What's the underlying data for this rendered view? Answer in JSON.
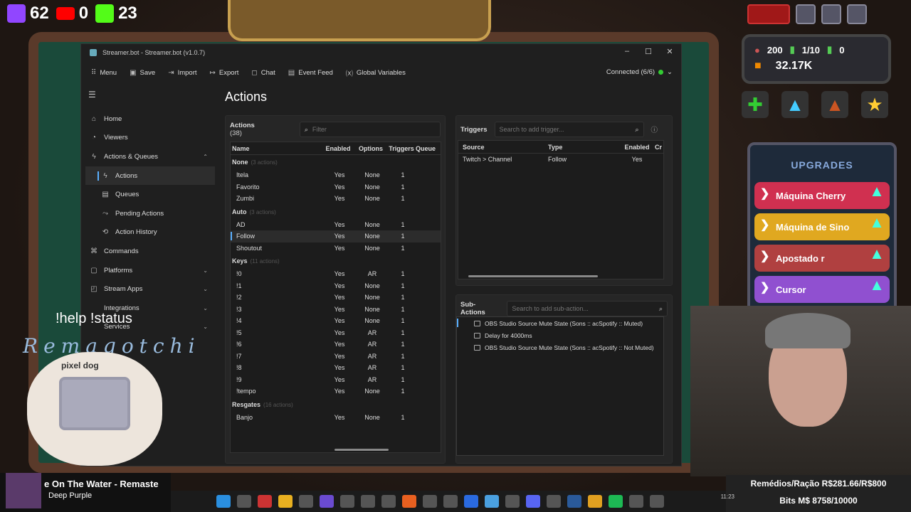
{
  "overlay": {
    "twitch_count": "62",
    "youtube_count": "0",
    "kick_count": "23",
    "help_text": "!help !status",
    "brand_name": "Remagotchi",
    "pet_brand": "pixel dog",
    "now_playing": {
      "title": "e On The Water - Remaste",
      "artist": "Deep Purple"
    },
    "game": {
      "stat1": "200",
      "stat2": "1/10",
      "stat3": "0",
      "money": "32.17K",
      "upgrades_title": "UPGRADES",
      "upgrades": [
        "Máquina Cherry",
        "Máquina de Sino",
        "Apostado r",
        "Cursor"
      ]
    },
    "bottom_line1": "Remédios/Ração R$281.66/R$800",
    "bottom_line2": "Bits M$ 8758/10000",
    "clock": "11:23"
  },
  "window": {
    "title": "Streamer.bot - Streamer.bot (v1.0.7)",
    "toolbar": [
      "Menu",
      "Save",
      "Import",
      "Export",
      "Chat",
      "Event Feed",
      "Global Variables"
    ],
    "connection": "Connected (6/6)",
    "nav": [
      {
        "label": "Home",
        "icon": "⌂",
        "sub": false
      },
      {
        "label": "Viewers",
        "icon": "◔",
        "sub": false
      },
      {
        "label": "Actions & Queues",
        "icon": "ϟ",
        "sub": false,
        "chev": "⌃"
      },
      {
        "label": "Actions",
        "icon": "ϟ",
        "sub": true,
        "active": true
      },
      {
        "label": "Queues",
        "icon": "▤",
        "sub": true
      },
      {
        "label": "Pending Actions",
        "icon": "⤳",
        "sub": true
      },
      {
        "label": "Action History",
        "icon": "⟲",
        "sub": true
      },
      {
        "label": "Commands",
        "icon": "⌘",
        "sub": false
      },
      {
        "label": "Platforms",
        "icon": "▢",
        "sub": false,
        "chev": "⌄"
      },
      {
        "label": "Stream Apps",
        "icon": "◰",
        "sub": false,
        "chev": "⌄"
      },
      {
        "label": "Integrations",
        "icon": "",
        "sub": false,
        "chev": "⌄"
      },
      {
        "label": "Services",
        "icon": "",
        "sub": false,
        "chev": "⌄"
      }
    ],
    "page_title": "Actions",
    "actions": {
      "label": "Actions",
      "count": "(38)",
      "filter_placeholder": "Filter",
      "columns": [
        "Name",
        "Enabled",
        "Options",
        "Triggers",
        "Queue"
      ],
      "groups": [
        {
          "name": "None",
          "count": "(3 actions)",
          "rows": [
            [
              "Itela",
              "Yes",
              "None",
              "1"
            ],
            [
              "Favorito",
              "Yes",
              "None",
              "1"
            ],
            [
              "Zumbi",
              "Yes",
              "None",
              "1"
            ]
          ]
        },
        {
          "name": "Auto",
          "count": "(3 actions)",
          "rows": [
            [
              "AD",
              "Yes",
              "None",
              "1"
            ],
            [
              "Follow",
              "Yes",
              "None",
              "1"
            ],
            [
              "Shoutout",
              "Yes",
              "None",
              "1"
            ]
          ]
        },
        {
          "name": "Keys",
          "count": "(11 actions)",
          "rows": [
            [
              "!0",
              "Yes",
              "AR",
              "1"
            ],
            [
              "!1",
              "Yes",
              "None",
              "1"
            ],
            [
              "!2",
              "Yes",
              "None",
              "1"
            ],
            [
              "!3",
              "Yes",
              "None",
              "1"
            ],
            [
              "!4",
              "Yes",
              "None",
              "1"
            ],
            [
              "!5",
              "Yes",
              "AR",
              "1"
            ],
            [
              "!6",
              "Yes",
              "AR",
              "1"
            ],
            [
              "!7",
              "Yes",
              "AR",
              "1"
            ],
            [
              "!8",
              "Yes",
              "AR",
              "1"
            ],
            [
              "!9",
              "Yes",
              "AR",
              "1"
            ],
            [
              "!tempo",
              "Yes",
              "None",
              "1"
            ]
          ]
        },
        {
          "name": "Resgates",
          "count": "(16 actions)",
          "rows": [
            [
              "Banjo",
              "Yes",
              "None",
              "1"
            ]
          ]
        }
      ]
    },
    "triggers": {
      "label": "Triggers",
      "search_placeholder": "Search to add trigger...",
      "columns": [
        "Source",
        "Type",
        "Enabled",
        "Cr"
      ],
      "rows": [
        [
          "Twitch > Channel",
          "Follow",
          "Yes"
        ]
      ]
    },
    "subactions": {
      "label": "Sub-Actions",
      "search_placeholder": "Search to add sub-action...",
      "rows": [
        "OBS Studio Source Mute State (Sons :: acSpotify :: Muted)",
        "Delay for 4000ms",
        "OBS Studio Source Mute State (Sons :: acSpotify :: Not Muted)"
      ]
    }
  }
}
